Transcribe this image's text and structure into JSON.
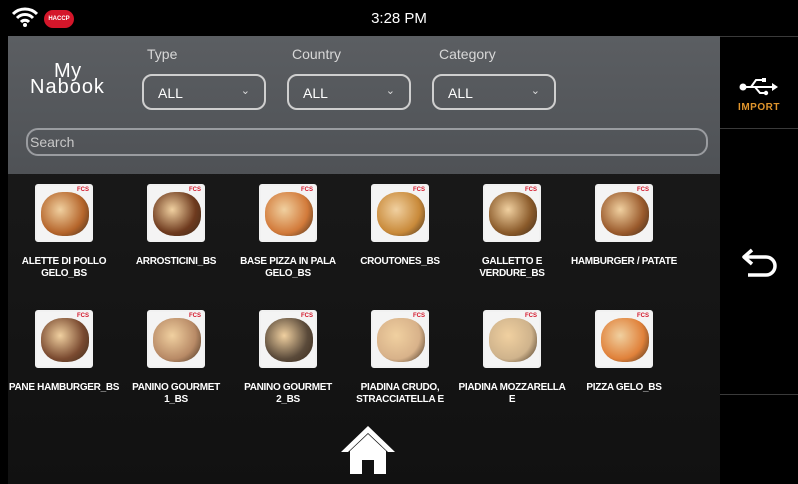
{
  "status": {
    "time": "3:28 PM",
    "haccp_badge": "HACCP"
  },
  "logo": {
    "line1": "My",
    "line2": "Nabook"
  },
  "filters": [
    {
      "label": "Type",
      "value": "ALL"
    },
    {
      "label": "Country",
      "value": "ALL"
    },
    {
      "label": "Category",
      "value": "ALL"
    }
  ],
  "search": {
    "placeholder": "Search"
  },
  "badge_text": "FCS",
  "items": [
    {
      "name": "ALETTE DI POLLO GELO_BS",
      "color": "#b5652b"
    },
    {
      "name": "ARROSTICINI_BS",
      "color": "#6e3a1e"
    },
    {
      "name": "BASE PIZZA IN PALA GELO_BS",
      "color": "#d27a3a"
    },
    {
      "name": "CROUTONES_BS",
      "color": "#c98a3a"
    },
    {
      "name": "GALLETTO E VERDURE_BS",
      "color": "#8a5a2a"
    },
    {
      "name": "HAMBURGER / PATATE",
      "color": "#9a5a2c"
    },
    {
      "name": "PANE HAMBURGER_BS",
      "color": "#7a4a30"
    },
    {
      "name": "PANINO GOURMET 1_BS",
      "color": "#b88a66"
    },
    {
      "name": "PANINO GOURMET 2_BS",
      "color": "#5a4a3a"
    },
    {
      "name": "PIADINA CRUDO, STRACCIATELLA E",
      "color": "#d8b28a"
    },
    {
      "name": "PIADINA MOZZARELLA E",
      "color": "#cfb38c"
    },
    {
      "name": "PIZZA GELO_BS",
      "color": "#e0813a"
    }
  ],
  "sidebar": {
    "import_label": "IMPORT"
  },
  "colors": {
    "accent": "#e0952c",
    "header": "#55585c",
    "haccp": "#d4162a"
  }
}
